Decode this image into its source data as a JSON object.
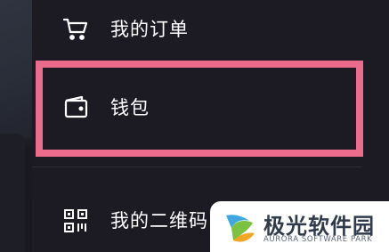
{
  "menu": {
    "items": [
      {
        "label": "我的订单",
        "icon": "shopping-cart-icon"
      },
      {
        "label": "钱包",
        "icon": "wallet-icon"
      },
      {
        "label": "我的二维码",
        "icon": "qr-code-icon"
      }
    ]
  },
  "highlight": {
    "color": "#ec6c8e"
  },
  "watermark": {
    "name": "极光软件园",
    "subtitle": "AURORA SOFTWARE PARK"
  }
}
